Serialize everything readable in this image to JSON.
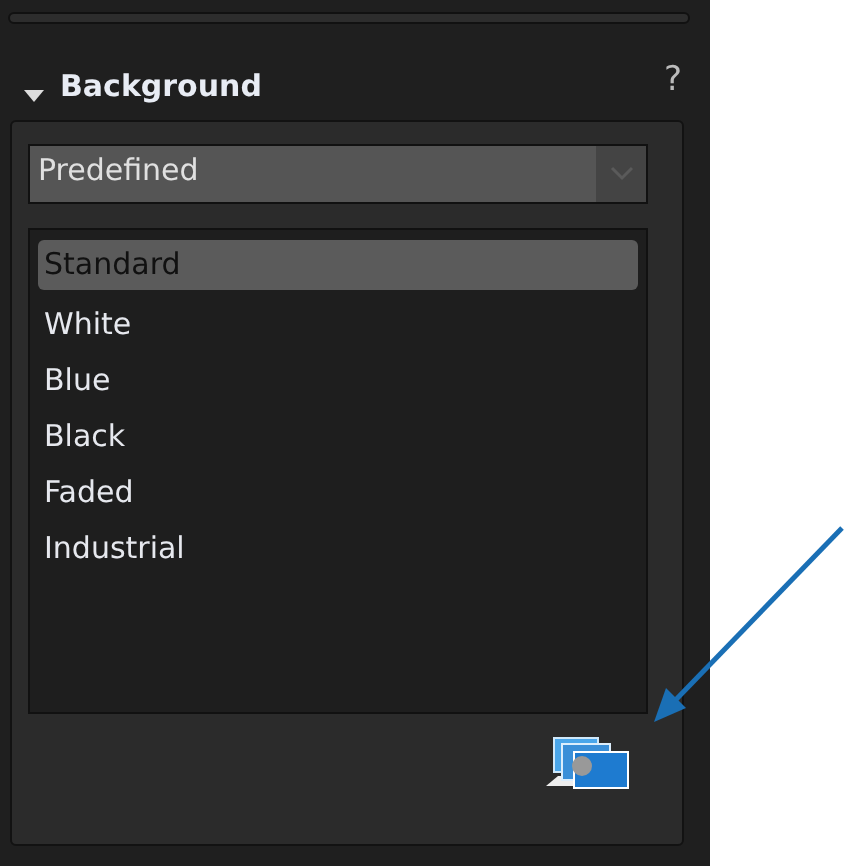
{
  "section": {
    "title": "Background",
    "expanded": true,
    "help": "?"
  },
  "dropdown": {
    "value": "Predefined"
  },
  "list": [
    {
      "label": "Standard",
      "selected": true
    },
    {
      "label": "White",
      "selected": false
    },
    {
      "label": "Blue",
      "selected": false
    },
    {
      "label": "Black",
      "selected": false
    },
    {
      "label": "Faded",
      "selected": false
    },
    {
      "label": "Industrial",
      "selected": false
    }
  ]
}
